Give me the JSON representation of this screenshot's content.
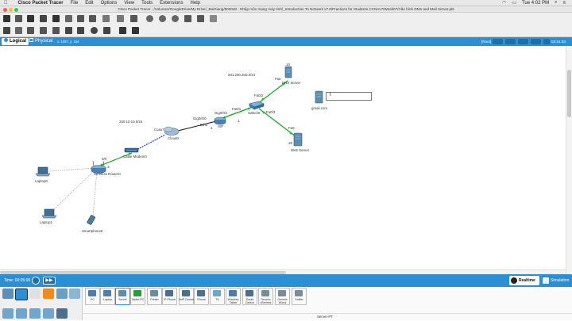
{
  "menubar": {
    "apple": "",
    "app_name": "Cisco Packet Tracer",
    "items": [
      "File",
      "Edit",
      "Options",
      "View",
      "Tools",
      "Extensions",
      "Help"
    ],
    "clock": "Tue 4:02 PM"
  },
  "window": {
    "title": "Cisco Packet Tracer - /Volumes/GoogleDrive/My Drive/_BaiGiang/502048 - Nhập môn mạng máy tính/_Introduction To Network v7.0/Practices for Students CCNAv7/Week07/Cấu hình DNS and Mail Server.pkt"
  },
  "tabs": {
    "logical": "Logical",
    "physical": "Physical",
    "coords": "x: 1097, y: 154",
    "root": "[Root]",
    "time_display": "02:31:33"
  },
  "canvas": {
    "network_labels": {
      "lan1": "200.10.10.0/24",
      "server_net": "201.200.200.0/24"
    },
    "devices": {
      "dns_server": {
        "name": "DNS Server",
        "ip": ".10",
        "port": "Fa0"
      },
      "web_server": {
        "name": "Web Server",
        "ip": ".20",
        "port": "Fa0"
      },
      "mail": {
        "name": "gmail.com"
      },
      "switch": {
        "name": "Switch0",
        "ports": [
          "Fa0/2",
          "Fa0/1",
          "Fa0/3"
        ]
      },
      "isp": {
        "name": "ISP",
        "ports": [
          "Gig0/0/0",
          "Gig0/0/1"
        ],
        "ips": [
          ".1",
          ".1"
        ]
      },
      "cloud": {
        "name": "Cloud0",
        "ports": [
          "Coax7",
          "Eth6"
        ]
      },
      "modem": {
        "name": "Cable Modem0"
      },
      "router": {
        "name": "Wireless Router0",
        "port": "0/0",
        "ip": ".2"
      },
      "laptop0": {
        "name": "Laptop0"
      },
      "laptop1": {
        "name": "Laptop1"
      },
      "smartphone": {
        "name": "Smartphone0"
      }
    },
    "rename_input": ""
  },
  "timebar": {
    "time": "Time: 00:05:00",
    "realtime": "Realtime",
    "simulation": "Simulation"
  },
  "device_panel": {
    "devices": [
      "PC",
      "Laptop",
      "Server",
      "Tablet-PC",
      "Printer",
      "IP Phone",
      "VoIP Device",
      "Phone",
      "TV",
      "Wireless Tablet",
      "Smart Device",
      "Generic Wireless",
      "Generic Wired",
      "Sniffer"
    ],
    "selected_label": "Server-PT"
  },
  "colors": {
    "accent_blue": "#2b8fd4",
    "link_green": "#0fa81a",
    "port_green": "#19c12a",
    "router_blue": "#4a7fb0",
    "server_blue": "#5b8fae"
  }
}
